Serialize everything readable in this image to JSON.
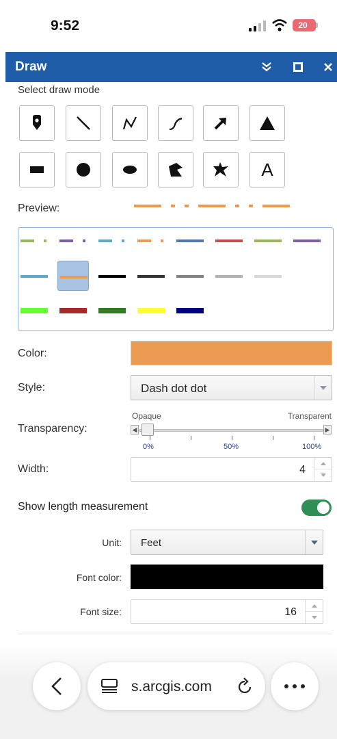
{
  "status_bar": {
    "time": "9:52",
    "battery": "20"
  },
  "header": {
    "title": "Draw"
  },
  "draw_mode": {
    "label": "Select draw mode",
    "tools": [
      {
        "name": "point",
        "icon": "map-pin-icon"
      },
      {
        "name": "line",
        "icon": "line-icon"
      },
      {
        "name": "polyline",
        "icon": "polyline-icon"
      },
      {
        "name": "freehand-line",
        "icon": "freehand-line-icon"
      },
      {
        "name": "arrow",
        "icon": "arrow-icon"
      },
      {
        "name": "triangle",
        "icon": "triangle-icon"
      },
      {
        "name": "rectangle",
        "icon": "rectangle-icon"
      },
      {
        "name": "circle",
        "icon": "circle-icon"
      },
      {
        "name": "ellipse",
        "icon": "ellipse-icon"
      },
      {
        "name": "polygon",
        "icon": "polygon-icon"
      },
      {
        "name": "freehand-polygon",
        "icon": "freehand-polygon-icon"
      },
      {
        "name": "text",
        "icon": "text-icon",
        "glyph": "A"
      }
    ]
  },
  "preview": {
    "label": "Preview:",
    "color": "#eb9a51"
  },
  "palette": {
    "rows": [
      [
        {
          "color": "#9ab55a",
          "style": "dashdot"
        },
        {
          "color": "#7f5ea8",
          "style": "dashdot"
        },
        {
          "color": "#5aa9c9",
          "style": "dashdot"
        },
        {
          "color": "#eb9a51",
          "style": "dashdot"
        },
        {
          "color": "#4f79b5",
          "style": "solid"
        },
        {
          "color": "#c0504d",
          "style": "solid"
        },
        {
          "color": "#9ab55a",
          "style": "solid"
        },
        {
          "color": "#7f5ea8",
          "style": "solid"
        }
      ],
      [
        {
          "color": "#5aa9c9",
          "style": "solid"
        },
        {
          "color": "#eb9a51",
          "style": "solid",
          "selected": true
        },
        {
          "color": "#000000",
          "style": "solid"
        },
        {
          "color": "#333333",
          "style": "solid"
        },
        {
          "color": "#808080",
          "style": "solid"
        },
        {
          "color": "#b3b3b3",
          "style": "solid"
        },
        {
          "color": "#d9d9d9",
          "style": "solid"
        }
      ],
      [
        {
          "color": "#66ff33",
          "style": "solid"
        },
        {
          "color": "#a52a2a",
          "style": "solid"
        },
        {
          "color": "#2e7d1f",
          "style": "solid"
        },
        {
          "color": "#ffff33",
          "style": "solid"
        },
        {
          "color": "#000080",
          "style": "solid"
        }
      ]
    ]
  },
  "color": {
    "label": "Color:",
    "value": "#eb9a51"
  },
  "style": {
    "label": "Style:",
    "value": "Dash dot dot"
  },
  "transparency": {
    "label": "Transparency:",
    "left_label": "Opaque",
    "right_label": "Transparent",
    "value_fraction": 0,
    "ticks": [
      "0%",
      "50%",
      "100%"
    ]
  },
  "width": {
    "label": "Width:",
    "value": "4"
  },
  "length_measurement": {
    "label": "Show length measurement",
    "enabled": true
  },
  "unit": {
    "label": "Unit:",
    "value": "Feet"
  },
  "font_color": {
    "label": "Font color:",
    "value": "#000000"
  },
  "font_size": {
    "label": "Font size:",
    "value": "16"
  },
  "browser": {
    "url": "s.arcgis.com"
  }
}
